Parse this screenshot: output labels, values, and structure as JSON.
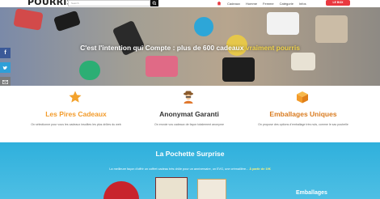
{
  "header": {
    "logo": "POURRIS",
    "search_placeholder": "Search",
    "nav": [
      "Cadeaux",
      "Homme",
      "Femme",
      "Catégorie",
      "Infos"
    ],
    "cta": "LE BOX"
  },
  "hero": {
    "title_main": "C'est l'intention qui Compte : plus de 600 cadeaux ",
    "title_accent": "vraiment pourris"
  },
  "features": [
    {
      "title": "Les Pires Cadeaux",
      "text": "On sélectionne pour vous les cadeaux insolites les plus drôles du web",
      "icon": "star-icon"
    },
    {
      "title": "Anonymat Garanti",
      "text": "On envoie vos cadeaux de façon totalement anonyme",
      "icon": "spy-icon"
    },
    {
      "title": "Emballages Uniques",
      "text": "On propose des options d'emballage très nuls, comme le sac poubelle",
      "icon": "box-icon"
    }
  ],
  "surprise": {
    "title": "La Pochette Surprise",
    "text": "La meilleure façon d'offrir un coffret cadeau très drôle pour un anniversaire, un EVG, une crémaillère... ",
    "accent": "À partir de 19€",
    "side_label": "Emballages"
  },
  "colors": {
    "accent": "#e9383f",
    "orange": "#f39b2a",
    "blue": "#2fb0dc"
  }
}
